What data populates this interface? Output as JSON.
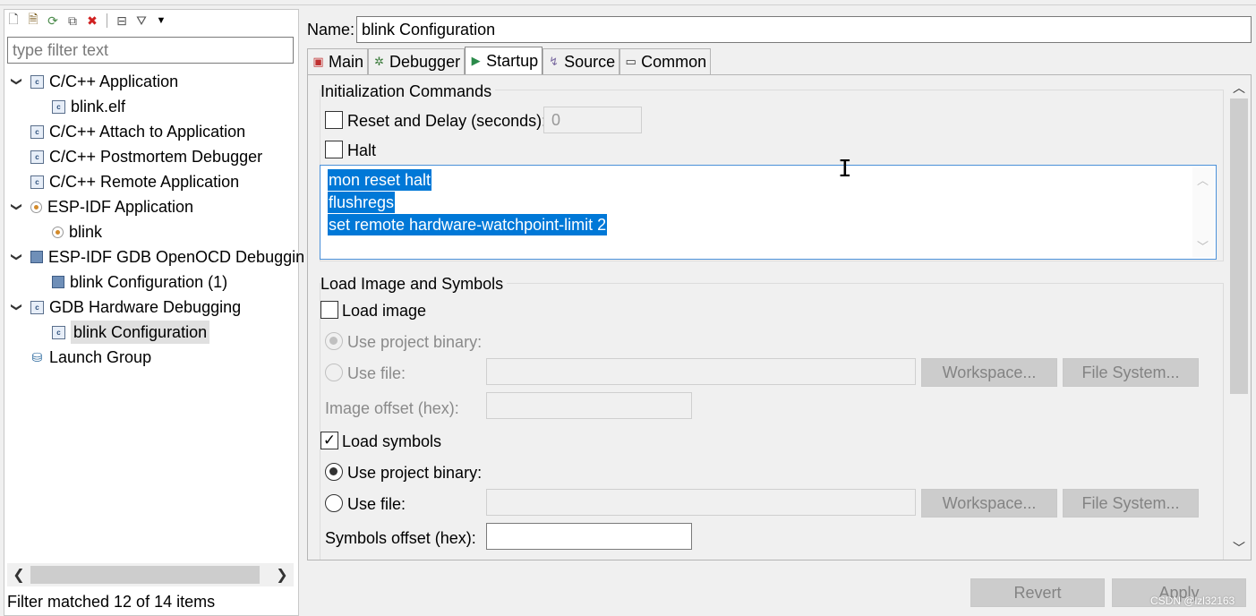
{
  "left": {
    "filter_placeholder": "type filter text",
    "tree": [
      {
        "label": "C/C++ Application",
        "level": 0,
        "expanded": true,
        "icon": "c-file-icon"
      },
      {
        "label": "blink.elf",
        "level": 1,
        "icon": "c-file-icon"
      },
      {
        "label": "C/C++ Attach to Application",
        "level": 0,
        "icon": "c-file-icon"
      },
      {
        "label": "C/C++ Postmortem Debugger",
        "level": 0,
        "icon": "c-file-icon"
      },
      {
        "label": "C/C++ Remote Application",
        "level": 0,
        "icon": "c-file-icon"
      },
      {
        "label": "ESP-IDF Application",
        "level": 0,
        "expanded": true,
        "icon": "esp-icon"
      },
      {
        "label": "blink",
        "level": 1,
        "icon": "esp-icon"
      },
      {
        "label": "ESP-IDF GDB OpenOCD Debuggin",
        "level": 0,
        "expanded": true,
        "icon": "bars-icon"
      },
      {
        "label": "blink Configuration (1)",
        "level": 1,
        "icon": "bars-icon"
      },
      {
        "label": "GDB Hardware Debugging",
        "level": 0,
        "expanded": true,
        "icon": "c-file-icon"
      },
      {
        "label": "blink Configuration",
        "level": 1,
        "selected": true,
        "icon": "c-file-icon"
      },
      {
        "label": "Launch Group",
        "level": 0,
        "icon": "launch-group-icon"
      }
    ],
    "status": "Filter matched 12 of 14 items"
  },
  "right": {
    "name_label": "Name:",
    "name_value": "blink Configuration",
    "tabs": [
      {
        "label": "Main",
        "icon": "main-tab-icon"
      },
      {
        "label": "Debugger",
        "icon": "debugger-bug-icon"
      },
      {
        "label": "Startup",
        "icon": "startup-play-icon",
        "active": true
      },
      {
        "label": "Source",
        "icon": "source-icon"
      },
      {
        "label": "Common",
        "icon": "common-icon"
      }
    ],
    "init": {
      "title": "Initialization Commands",
      "reset_label": "Reset and Delay (seconds):",
      "reset_value": "0",
      "halt_label": "Halt",
      "commands": [
        "mon reset halt",
        "flushregs",
        "set remote hardware-watchpoint-limit 2"
      ]
    },
    "load": {
      "title": "Load Image and Symbols",
      "load_image_label": "Load image",
      "use_project_binary": "Use project binary:",
      "use_file": "Use file:",
      "workspace": "Workspace...",
      "file_system": "File System...",
      "image_offset": "Image offset (hex):",
      "load_symbols_label": "Load symbols",
      "symbols_offset": "Symbols offset (hex):"
    },
    "revert": "Revert",
    "apply": "Apply"
  },
  "watermark": "CSDN @lzl32163",
  "colors": {
    "selection": "#0078d7",
    "focus_border": "#4a90d9",
    "disabled_button": "#cccccc"
  }
}
